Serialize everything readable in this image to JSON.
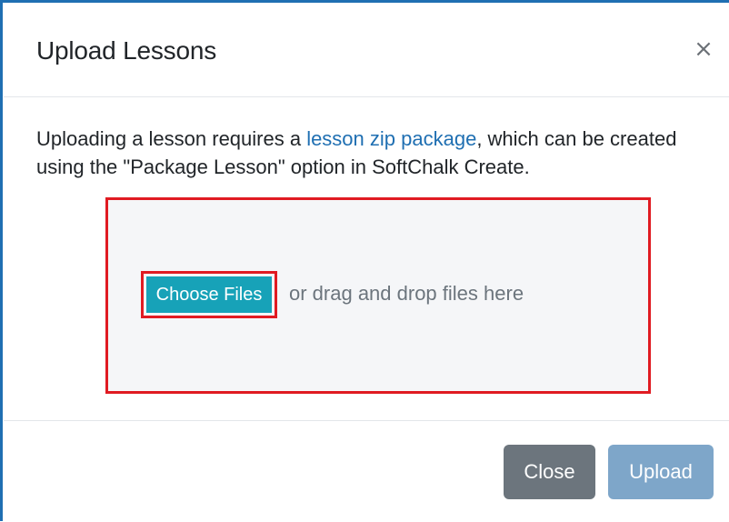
{
  "dialog": {
    "title": "Upload Lessons",
    "close_icon": "close-icon",
    "close_symbol": "×"
  },
  "body": {
    "text_before_link": "Uploading a lesson requires a ",
    "link_text": "lesson zip package",
    "text_after_link": ", which can be created using the \"Package Lesson\" option in SoftChalk Create."
  },
  "dropzone": {
    "choose_files_label": "Choose Files",
    "hint": "or drag and drop files here"
  },
  "footer": {
    "close_label": "Close",
    "upload_label": "Upload"
  },
  "colors": {
    "link": "#1f6fb2",
    "choose_button": "#17a2b8",
    "highlight_outline": "#e01b22",
    "close_button": "#6c757d",
    "upload_button_disabled": "#7ea6c9"
  }
}
